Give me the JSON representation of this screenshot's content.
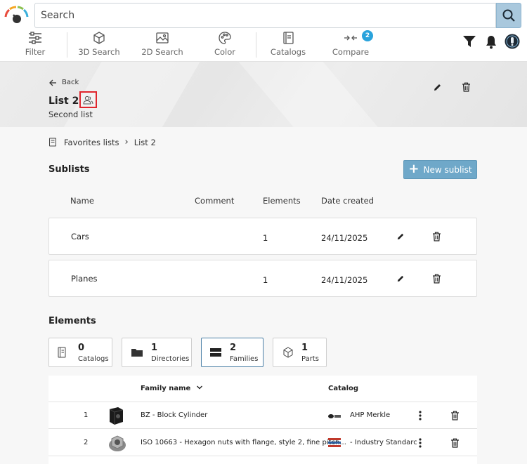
{
  "search": {
    "placeholder": "Search"
  },
  "toolbar": {
    "filter": "Filter",
    "search3d": "3D Search",
    "search2d": "2D Search",
    "color": "Color",
    "catalogs": "Catalogs",
    "compare": "Compare",
    "compare_count": "2"
  },
  "header": {
    "back": "Back",
    "title": "List 2",
    "subtitle": "Second list"
  },
  "breadcrumb": {
    "root": "Favorites lists",
    "current": "List 2"
  },
  "sublists": {
    "title": "Sublists",
    "new_button": "New sublist",
    "columns": {
      "name": "Name",
      "comment": "Comment",
      "elements": "Elements",
      "date": "Date created"
    },
    "rows": [
      {
        "name": "Cars",
        "comment": "",
        "elements": "1",
        "date": "24/11/2025"
      },
      {
        "name": "Planes",
        "comment": "",
        "elements": "1",
        "date": "24/11/2025"
      }
    ]
  },
  "elements": {
    "title": "Elements",
    "filters": [
      {
        "count": "0",
        "label": "Catalogs"
      },
      {
        "count": "1",
        "label": "Directories"
      },
      {
        "count": "2",
        "label": "Families"
      },
      {
        "count": "1",
        "label": "Parts"
      }
    ],
    "columns": {
      "family": "Family name",
      "catalog": "Catalog"
    },
    "rows": [
      {
        "index": "1",
        "family": "BZ - Block Cylinder",
        "catalog": "AHP Merkle"
      },
      {
        "index": "2",
        "family": "ISO 10663 - Hexagon nuts with flange, style 2, fine pitch...",
        "catalog": "- Industry Standarc"
      }
    ]
  },
  "colors": {
    "accent": "#6fa8c9",
    "highlight": "#e0262e",
    "badge": "#2aa3dc"
  }
}
